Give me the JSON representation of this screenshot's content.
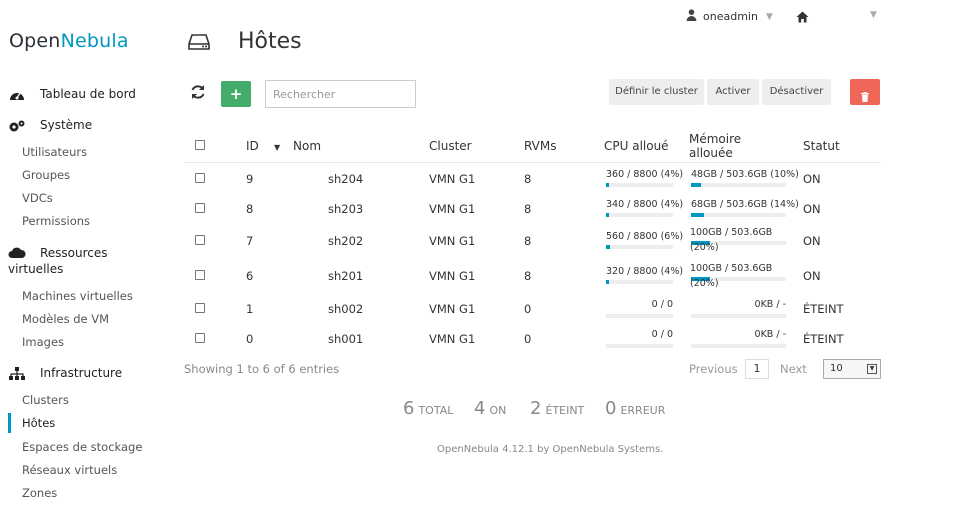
{
  "brand": {
    "part1": "Open",
    "part2": "Nebula"
  },
  "topbar": {
    "user": "oneadmin"
  },
  "sidebar": {
    "sections": [
      {
        "label": "Tableau de bord"
      },
      {
        "label": "Système"
      },
      {
        "label_line1": "Ressources",
        "label_line2": "virtuelles"
      },
      {
        "label": "Infrastructure"
      }
    ],
    "system_items": [
      "Utilisateurs",
      "Groupes",
      "VDCs",
      "Permissions"
    ],
    "virtual_items": [
      "Machines virtuelles",
      "Modèles de VM",
      "Images"
    ],
    "infra_items": [
      "Clusters",
      "Hôtes",
      "Espaces de stockage",
      "Réseaux virtuels",
      "Zones"
    ],
    "active": "Hôtes"
  },
  "page": {
    "title": "Hôtes"
  },
  "toolbar": {
    "add_label": "+",
    "search_placeholder": "Rechercher",
    "set_cluster": "Définir le cluster",
    "enable": "Activer",
    "disable": "Désactiver"
  },
  "table": {
    "headers": {
      "id": "ID",
      "name": "Nom",
      "cluster": "Cluster",
      "rvms": "RVMs",
      "cpu": "CPU alloué",
      "mem_line1": "Mémoire",
      "mem_line2": "allouée",
      "status": "Statut"
    },
    "rows": [
      {
        "id": "9",
        "name": "sh204",
        "cluster": "VMN G1",
        "rvms": "8",
        "cpu": "360 / 8800 (4%)",
        "cpu_pct": 4,
        "mem": "48GB / 503.6GB (10%)",
        "mem_pct": 10,
        "status": "ON"
      },
      {
        "id": "8",
        "name": "sh203",
        "cluster": "VMN G1",
        "rvms": "8",
        "cpu": "340 / 8800 (4%)",
        "cpu_pct": 4,
        "mem": "68GB / 503.6GB (14%)",
        "mem_pct": 14,
        "status": "ON"
      },
      {
        "id": "7",
        "name": "sh202",
        "cluster": "VMN G1",
        "rvms": "8",
        "cpu": "560 / 8800 (6%)",
        "cpu_pct": 6,
        "mem1": "100GB / 503.6GB",
        "mem2": "(20%)",
        "mem_pct": 20,
        "status": "ON"
      },
      {
        "id": "6",
        "name": "sh201",
        "cluster": "VMN G1",
        "rvms": "8",
        "cpu": "320 / 8800 (4%)",
        "cpu_pct": 4,
        "mem1": "100GB / 503.6GB",
        "mem2": "(20%)",
        "mem_pct": 20,
        "status": "ON"
      },
      {
        "id": "1",
        "name": "sh002",
        "cluster": "VMN G1",
        "rvms": "0",
        "cpu": "0 / 0",
        "cpu_pct": 0,
        "mem": "0KB / -",
        "mem_pct": 0,
        "status": "ÉTEINT"
      },
      {
        "id": "0",
        "name": "sh001",
        "cluster": "VMN G1",
        "rvms": "0",
        "cpu": "0 / 0",
        "cpu_pct": 0,
        "mem": "0KB / -",
        "mem_pct": 0,
        "status": "ÉTEINT"
      }
    ]
  },
  "pagination": {
    "showing": "Showing 1 to 6 of 6 entries",
    "previous": "Previous",
    "current": "1",
    "next": "Next",
    "page_size": "10"
  },
  "stats": [
    {
      "num": "6",
      "label": "TOTAL"
    },
    {
      "num": "4",
      "label": "ON"
    },
    {
      "num": "2",
      "label": "ÉTEINT"
    },
    {
      "num": "0",
      "label": "ERREUR"
    }
  ],
  "footer": "OpenNebula 4.12.1 by OpenNebula Systems.",
  "colors": {
    "accent": "#0098c3",
    "add": "#43ac6a",
    "delete": "#f0675a"
  }
}
